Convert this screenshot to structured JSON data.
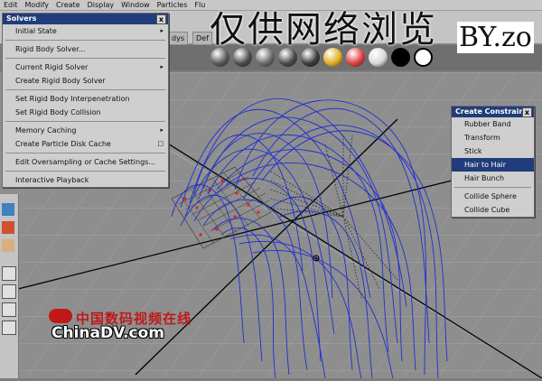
{
  "menubar": {
    "items": [
      "Edit",
      "Modify",
      "Create",
      "Display",
      "Window",
      "Particles",
      "Flu"
    ]
  },
  "toolbar": {
    "tabs": [
      "dys",
      "Def"
    ]
  },
  "shelf": {
    "ball_colors": [
      "#5a5a5a",
      "#4e4e4e",
      "#6a6a6a",
      "#4a4a4a",
      "#3c3c3c",
      "#e0b020",
      "#e04040",
      "#d8d8d8",
      "#000000",
      "#ffffff"
    ]
  },
  "solvers_menu": {
    "title": "Solvers",
    "close": "x",
    "items": [
      {
        "label": "Initial State",
        "arrow": "▸"
      },
      {
        "sep": true
      },
      {
        "label": "Rigid Body Solver..."
      },
      {
        "sep": true
      },
      {
        "label": "Current Rigid Solver",
        "arrow": "▸"
      },
      {
        "label": "Create Rigid Body Solver"
      },
      {
        "sep": true
      },
      {
        "label": "Set Rigid Body Interpenetration"
      },
      {
        "label": "Set Rigid Body Collision"
      },
      {
        "sep": true
      },
      {
        "label": "Memory Caching",
        "arrow": "▸"
      },
      {
        "label": "Create Particle Disk Cache",
        "arrow": "□"
      },
      {
        "sep": true
      },
      {
        "label": "Edit Oversampling or Cache Settings..."
      },
      {
        "sep": true
      },
      {
        "label": "Interactive Playback"
      }
    ]
  },
  "constraint_menu": {
    "title": "Create Constraint",
    "close": "x",
    "items": [
      {
        "label": "Rubber Band"
      },
      {
        "label": "Transform"
      },
      {
        "label": "Stick"
      },
      {
        "label": "Hair to Hair",
        "selected": true
      },
      {
        "label": "Hair Bunch"
      },
      {
        "sep": true
      },
      {
        "label": "Collide Sphere"
      },
      {
        "label": "Collide Cube"
      }
    ]
  },
  "watermark": {
    "text": "仅供网络浏览",
    "by": "BY.zo"
  },
  "logo": {
    "cn": "中国数码视频在线",
    "en": "ChinaDV.com"
  }
}
